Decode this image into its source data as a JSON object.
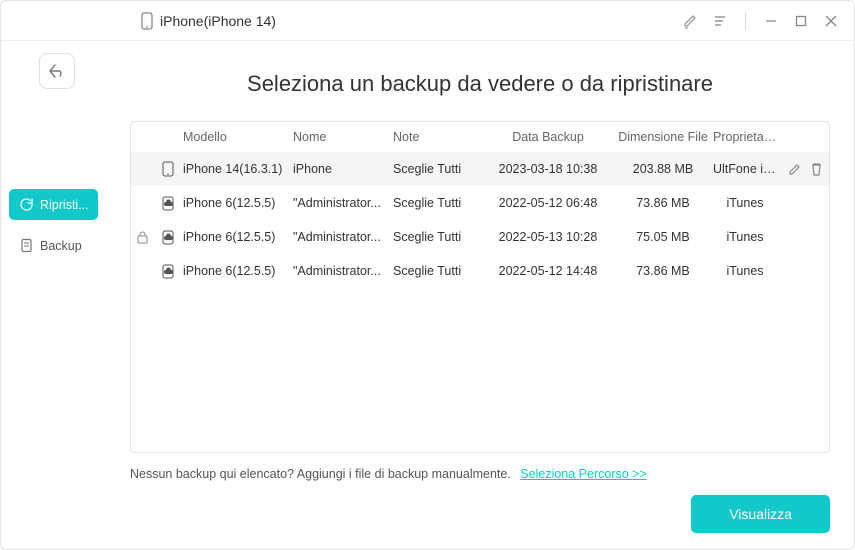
{
  "header": {
    "device_name": "iPhone(iPhone 14)"
  },
  "sidebar": {
    "restore_label": "Ripristi...",
    "backup_label": "Backup"
  },
  "main": {
    "title": "Seleziona un backup da vedere o da ripristinare",
    "columns": {
      "model": "Modello",
      "name": "Nome",
      "note": "Note",
      "date": "Data Backup",
      "size": "Dimensione File",
      "owner": "Proprietario"
    },
    "rows": [
      {
        "locked": false,
        "device_type": "phone",
        "model": "iPhone 14(16.3.1)",
        "name": "iPhone",
        "note": "Sceglie Tutti",
        "date": "2023-03-18 10:38",
        "size": "203.88 MB",
        "owner": "UltFone iOS Data...",
        "selected": true,
        "editable": true
      },
      {
        "locked": false,
        "device_type": "cloud",
        "model": "iPhone 6(12.5.5)",
        "name": "\"Administrator...",
        "note": "Sceglie Tutti",
        "date": "2022-05-12 06:48",
        "size": "73.86 MB",
        "owner": "iTunes",
        "selected": false,
        "editable": false
      },
      {
        "locked": true,
        "device_type": "cloud",
        "model": "iPhone 6(12.5.5)",
        "name": "\"Administrator...",
        "note": "Sceglie Tutti",
        "date": "2022-05-13 10:28",
        "size": "75.05 MB",
        "owner": "iTunes",
        "selected": false,
        "editable": false
      },
      {
        "locked": false,
        "device_type": "cloud",
        "model": "iPhone 6(12.5.5)",
        "name": "\"Administrator...",
        "note": "Sceglie Tutti",
        "date": "2022-05-12 14:48",
        "size": "73.86 MB",
        "owner": "iTunes",
        "selected": false,
        "editable": false
      }
    ],
    "hint_text": "Nessun backup qui elencato? Aggiungi i file di backup manualmente.",
    "hint_link": "Seleziona Percorso >>",
    "view_button": "Visualizza"
  }
}
